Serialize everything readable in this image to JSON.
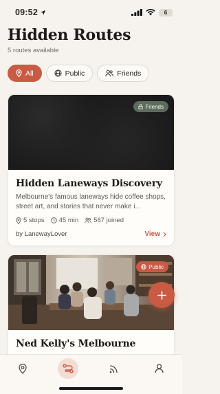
{
  "status_bar": {
    "time": "09:52",
    "battery": "6"
  },
  "header": {
    "title": "Hidden Routes",
    "subtitle": "5 routes available"
  },
  "filters": [
    {
      "label": "All",
      "active": true
    },
    {
      "label": "Public",
      "active": false
    },
    {
      "label": "Friends",
      "active": false
    }
  ],
  "routes": [
    {
      "visibility": "Friends",
      "title": "Hidden Laneways Discovery",
      "description": "Melbourne's famous laneways hide coffee shops, street art, and stories that never make i...",
      "stops": "5 stops",
      "duration": "45 min",
      "joined": "567 joined",
      "author": "by LanewayLover",
      "action": "View"
    },
    {
      "visibility": "Public",
      "title": "Ned Kelly's Melbourne"
    }
  ],
  "fab": {
    "icon": "plus-icon"
  },
  "tab_bar": [
    {
      "icon": "map-pin-icon",
      "active": false
    },
    {
      "icon": "route-icon",
      "active": true
    },
    {
      "icon": "feed-icon",
      "active": false
    },
    {
      "icon": "profile-icon",
      "active": false
    }
  ],
  "colors": {
    "accent": "#c95a43",
    "background": "#f6f3ee",
    "friends_badge": "#5b6b5c"
  }
}
